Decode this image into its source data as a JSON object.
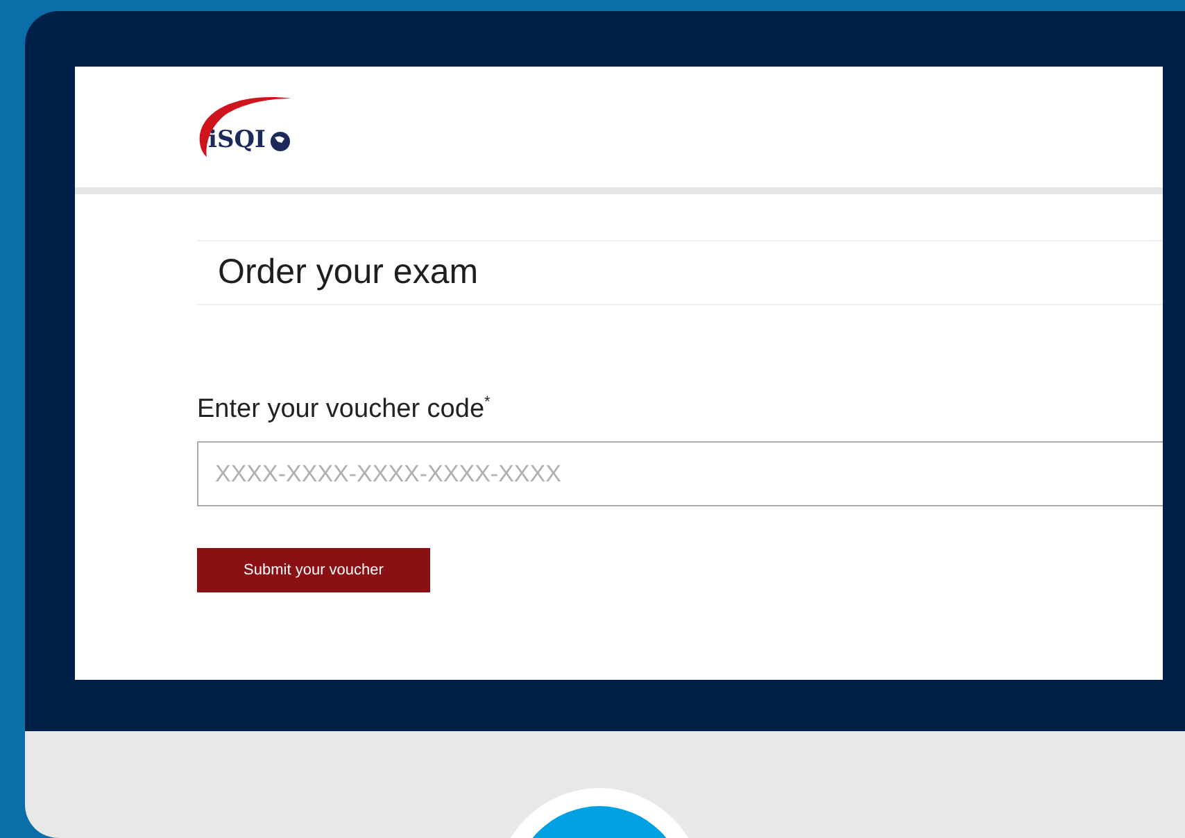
{
  "logo": {
    "text": "iSQI"
  },
  "page_title": "Order your exam",
  "voucher": {
    "label": "Enter your voucher code",
    "required_mark": "*",
    "placeholder": "XXXX-XXXX-XXXX-XXXX-XXXX"
  },
  "submit_button": "Submit your voucher"
}
